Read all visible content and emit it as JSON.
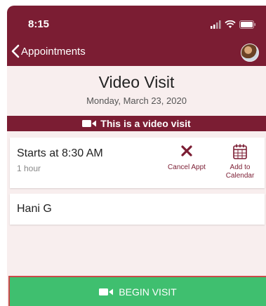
{
  "status_bar": {
    "time": "8:15"
  },
  "nav": {
    "back_label": "Appointments"
  },
  "visit": {
    "title": "Video Visit",
    "date": "Monday, March 23, 2020",
    "banner": "This is a video visit"
  },
  "appointment": {
    "start": "Starts at 8:30 AM",
    "duration": "1 hour",
    "cancel_label": "Cancel Appt",
    "add_label_line1": "Add to",
    "add_label_line2": "Calendar"
  },
  "provider": {
    "name": "Hani G"
  },
  "begin_button": {
    "label": "BEGIN VISIT"
  },
  "colors": {
    "brand": "#7b1d33",
    "background": "#f8eeee",
    "begin": "#3fbf6f"
  }
}
